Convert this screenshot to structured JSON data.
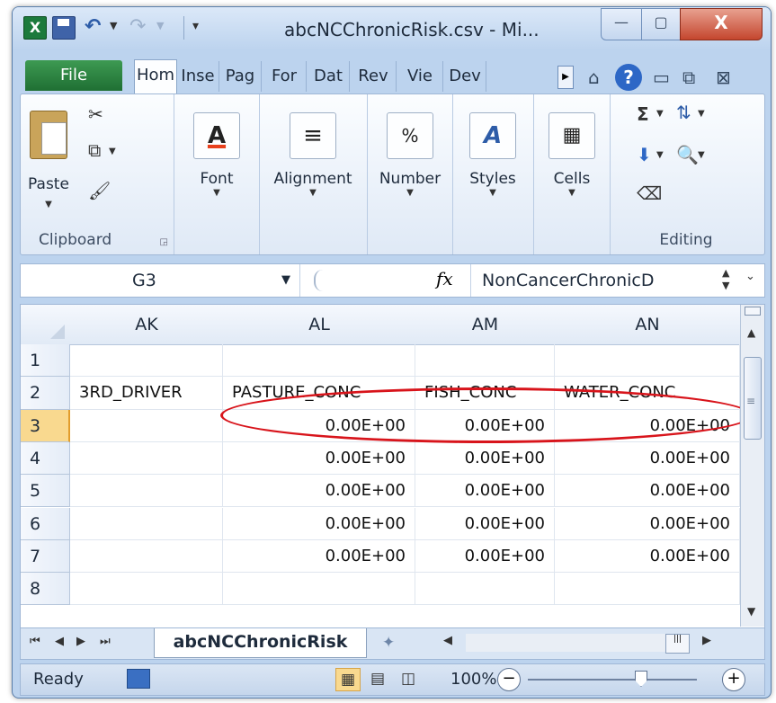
{
  "window": {
    "title": "abcNCChronicRisk.csv - Mi..."
  },
  "titlebar_controls": {
    "minimize": "—",
    "maximize": "▢",
    "close": "X"
  },
  "ribbon_tabs": [
    {
      "label": "File"
    },
    {
      "label": "Hom"
    },
    {
      "label": "Inse"
    },
    {
      "label": "Pag"
    },
    {
      "label": "For"
    },
    {
      "label": "Dat"
    },
    {
      "label": "Rev"
    },
    {
      "label": "Vie"
    },
    {
      "label": "Dev"
    }
  ],
  "ribbon": {
    "clipboard": {
      "paste_label": "Paste",
      "group_label": "Clipboard"
    },
    "font": {
      "label": "Font"
    },
    "alignment": {
      "label": "Alignment"
    },
    "number": {
      "label": "Number",
      "icon_text": "%"
    },
    "styles": {
      "label": "Styles"
    },
    "cells": {
      "label": "Cells"
    },
    "editing": {
      "group_label": "Editing"
    }
  },
  "formula_bar": {
    "name_box": "G3",
    "fx": "fx",
    "content": "NonCancerChronicD"
  },
  "sheet": {
    "columns": [
      "AK",
      "AL",
      "AM",
      "AN"
    ],
    "rows": [
      {
        "num": "1",
        "cells": [
          "",
          "",
          "",
          ""
        ]
      },
      {
        "num": "2",
        "cells": [
          "3RD_DRIVER",
          "PASTURE_CONC",
          "FISH_CONC",
          "WATER_CONC"
        ]
      },
      {
        "num": "3",
        "cells": [
          "",
          "0.00E+00",
          "0.00E+00",
          "0.00E+00"
        ]
      },
      {
        "num": "4",
        "cells": [
          "",
          "0.00E+00",
          "0.00E+00",
          "0.00E+00"
        ]
      },
      {
        "num": "5",
        "cells": [
          "",
          "0.00E+00",
          "0.00E+00",
          "0.00E+00"
        ]
      },
      {
        "num": "6",
        "cells": [
          "",
          "0.00E+00",
          "0.00E+00",
          "0.00E+00"
        ]
      },
      {
        "num": "7",
        "cells": [
          "",
          "0.00E+00",
          "0.00E+00",
          "0.00E+00"
        ]
      },
      {
        "num": "8",
        "cells": [
          "",
          "",
          "",
          ""
        ]
      }
    ],
    "selected_row": "3",
    "tab_name": "abcNCChronicRisk"
  },
  "statusbar": {
    "ready": "Ready",
    "zoom": "100%"
  },
  "accent_colors": {
    "highlight_oval": "#d8141b",
    "selected_row_header": "#f9d98f",
    "file_tab": "#1f6f33"
  }
}
